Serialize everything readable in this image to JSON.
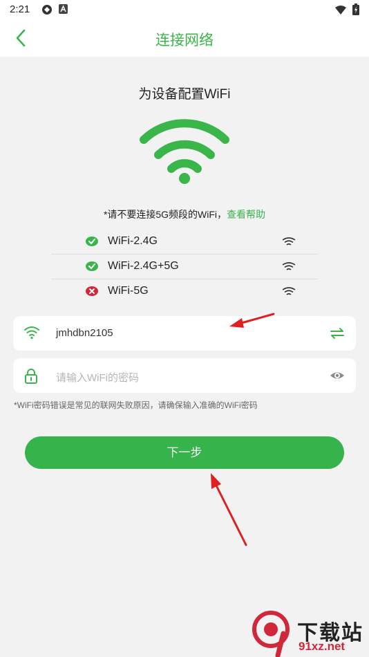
{
  "status_bar": {
    "time": "2:21"
  },
  "header": {
    "title": "连接网络"
  },
  "main": {
    "subtitle": "为设备配置WiFi",
    "note_prefix": "*请不要连接5G频段的WiFi，",
    "note_link": "查看帮助",
    "bands": [
      {
        "label": "WiFi-2.4G",
        "supported": true
      },
      {
        "label": "WiFi-2.4G+5G",
        "supported": true
      },
      {
        "label": "WiFi-5G",
        "supported": false
      }
    ],
    "ssid_field": {
      "value": "jmhdbn2105"
    },
    "password_field": {
      "placeholder": "请输入WiFi的密码"
    },
    "hint": "*WiFi密码错误是常见的联网失败原因，请确保输入准确的WiFi密码",
    "next_button": "下一步"
  },
  "watermark": {
    "text": "下载站",
    "url_text": "91xz.net"
  },
  "colors": {
    "accent": "#3ab54a",
    "button": "#36b34b",
    "error": "#d0283a",
    "arrow": "#e02020"
  }
}
